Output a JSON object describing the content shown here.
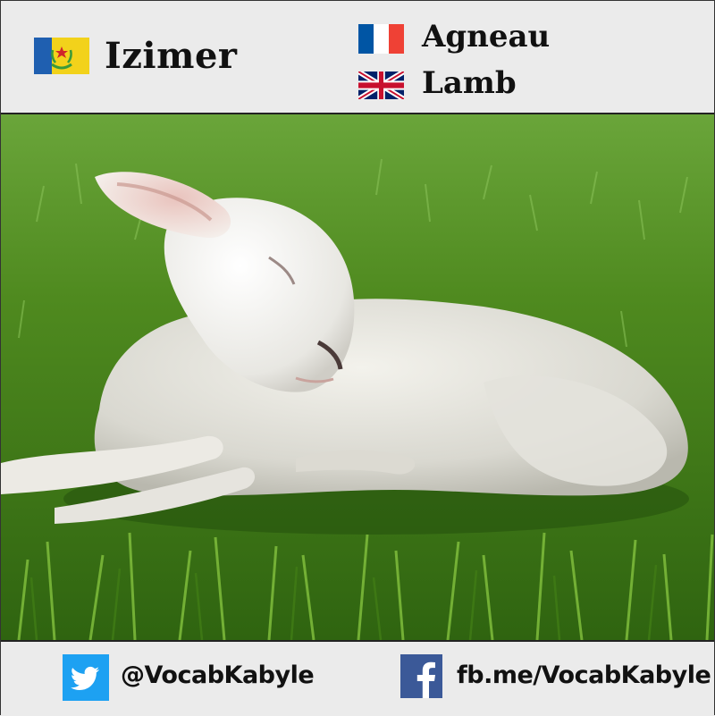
{
  "header": {
    "kabyle_word": "Izimer",
    "french_word": "Agneau",
    "english_word": "Lamb"
  },
  "photo": {
    "subject": "lamb-image"
  },
  "footer": {
    "twitter_handle": "@VocabKabyle",
    "facebook_link": "fb.me/VocabKabyle"
  },
  "colors": {
    "background": "#ebebeb",
    "grass": "#4f8a1f",
    "twitter_blue": "#1da1f2",
    "facebook_blue": "#3b5998",
    "french_blue": "#0055a4",
    "french_red": "#ef4135"
  }
}
